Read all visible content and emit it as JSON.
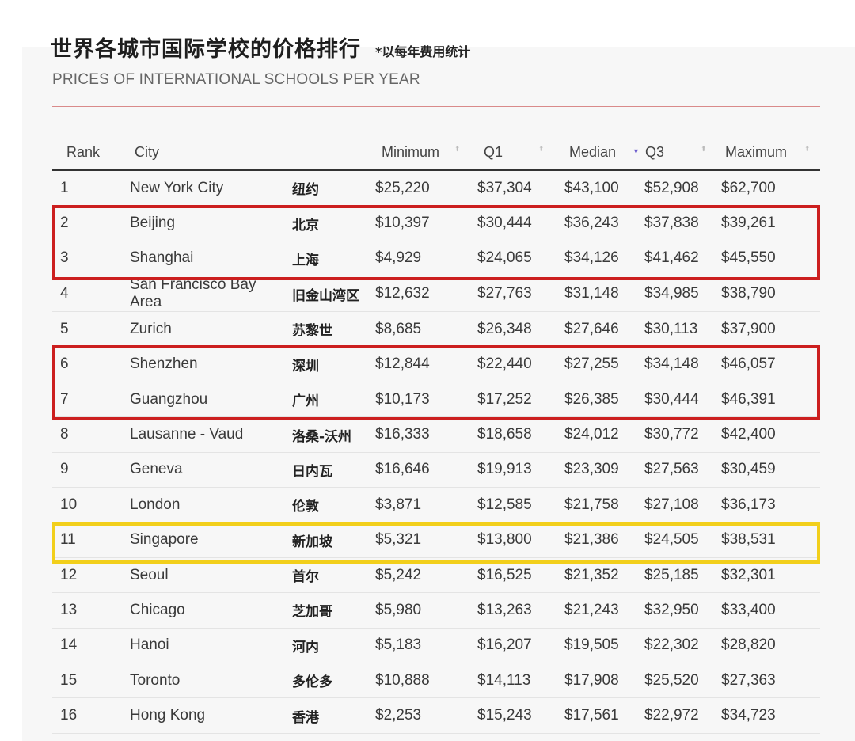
{
  "title": "世界各城市国际学校的价格排行",
  "note": "*以每年费用统计",
  "subtitle": "PRICES OF INTERNATIONAL SCHOOLS PER YEAR",
  "columns": {
    "rank": "Rank",
    "city": "City",
    "min": "Minimum",
    "q1": "Q1",
    "median": "Median",
    "q3": "Q3",
    "max": "Maximum"
  },
  "sort_icons": {
    "inactive": "⬍",
    "active": "▼"
  },
  "highlight_colors": {
    "red": "#cc1f1f",
    "yellow": "#f2cf1b"
  },
  "rows": [
    {
      "rank": "1",
      "city": "New York City",
      "city_zh": "纽约",
      "min": "$25,220",
      "q1": "$37,304",
      "median": "$43,100",
      "q3": "$52,908",
      "max": "$62,700"
    },
    {
      "rank": "2",
      "city": "Beijing",
      "city_zh": "北京",
      "min": "$10,397",
      "q1": "$30,444",
      "median": "$36,243",
      "q3": "$37,838",
      "max": "$39,261"
    },
    {
      "rank": "3",
      "city": "Shanghai",
      "city_zh": "上海",
      "min": "$4,929",
      "q1": "$24,065",
      "median": "$34,126",
      "q3": "$41,462",
      "max": "$45,550"
    },
    {
      "rank": "4",
      "city": "San Francisco Bay Area",
      "city_zh": "旧金山湾区",
      "min": "$12,632",
      "q1": "$27,763",
      "median": "$31,148",
      "q3": "$34,985",
      "max": "$38,790"
    },
    {
      "rank": "5",
      "city": "Zurich",
      "city_zh": "苏黎世",
      "min": "$8,685",
      "q1": "$26,348",
      "median": "$27,646",
      "q3": "$30,113",
      "max": "$37,900"
    },
    {
      "rank": "6",
      "city": "Shenzhen",
      "city_zh": "深圳",
      "min": "$12,844",
      "q1": "$22,440",
      "median": "$27,255",
      "q3": "$34,148",
      "max": "$46,057"
    },
    {
      "rank": "7",
      "city": "Guangzhou",
      "city_zh": "广州",
      "min": "$10,173",
      "q1": "$17,252",
      "median": "$26,385",
      "q3": "$30,444",
      "max": "$46,391"
    },
    {
      "rank": "8",
      "city": "Lausanne - Vaud",
      "city_zh": "洛桑-沃州",
      "min": "$16,333",
      "q1": "$18,658",
      "median": "$24,012",
      "q3": "$30,772",
      "max": "$42,400"
    },
    {
      "rank": "9",
      "city": "Geneva",
      "city_zh": "日内瓦",
      "min": "$16,646",
      "q1": "$19,913",
      "median": "$23,309",
      "q3": "$27,563",
      "max": "$30,459"
    },
    {
      "rank": "10",
      "city": "London",
      "city_zh": "伦敦",
      "min": "$3,871",
      "q1": "$12,585",
      "median": "$21,758",
      "q3": "$27,108",
      "max": "$36,173"
    },
    {
      "rank": "11",
      "city": "Singapore",
      "city_zh": "新加坡",
      "min": "$5,321",
      "q1": "$13,800",
      "median": "$21,386",
      "q3": "$24,505",
      "max": "$38,531"
    },
    {
      "rank": "12",
      "city": "Seoul",
      "city_zh": "首尔",
      "min": "$5,242",
      "q1": "$16,525",
      "median": "$21,352",
      "q3": "$25,185",
      "max": "$32,301"
    },
    {
      "rank": "13",
      "city": "Chicago",
      "city_zh": "芝加哥",
      "min": "$5,980",
      "q1": "$13,263",
      "median": "$21,243",
      "q3": "$32,950",
      "max": "$33,400"
    },
    {
      "rank": "14",
      "city": "Hanoi",
      "city_zh": "河内",
      "min": "$5,183",
      "q1": "$16,207",
      "median": "$19,505",
      "q3": "$22,302",
      "max": "$28,820"
    },
    {
      "rank": "15",
      "city": "Toronto",
      "city_zh": "多伦多",
      "min": "$10,888",
      "q1": "$14,113",
      "median": "$17,908",
      "q3": "$25,520",
      "max": "$27,363"
    },
    {
      "rank": "16",
      "city": "Hong Kong",
      "city_zh": "香港",
      "min": "$2,253",
      "q1": "$15,243",
      "median": "$17,561",
      "q3": "$22,972",
      "max": "$34,723"
    }
  ]
}
